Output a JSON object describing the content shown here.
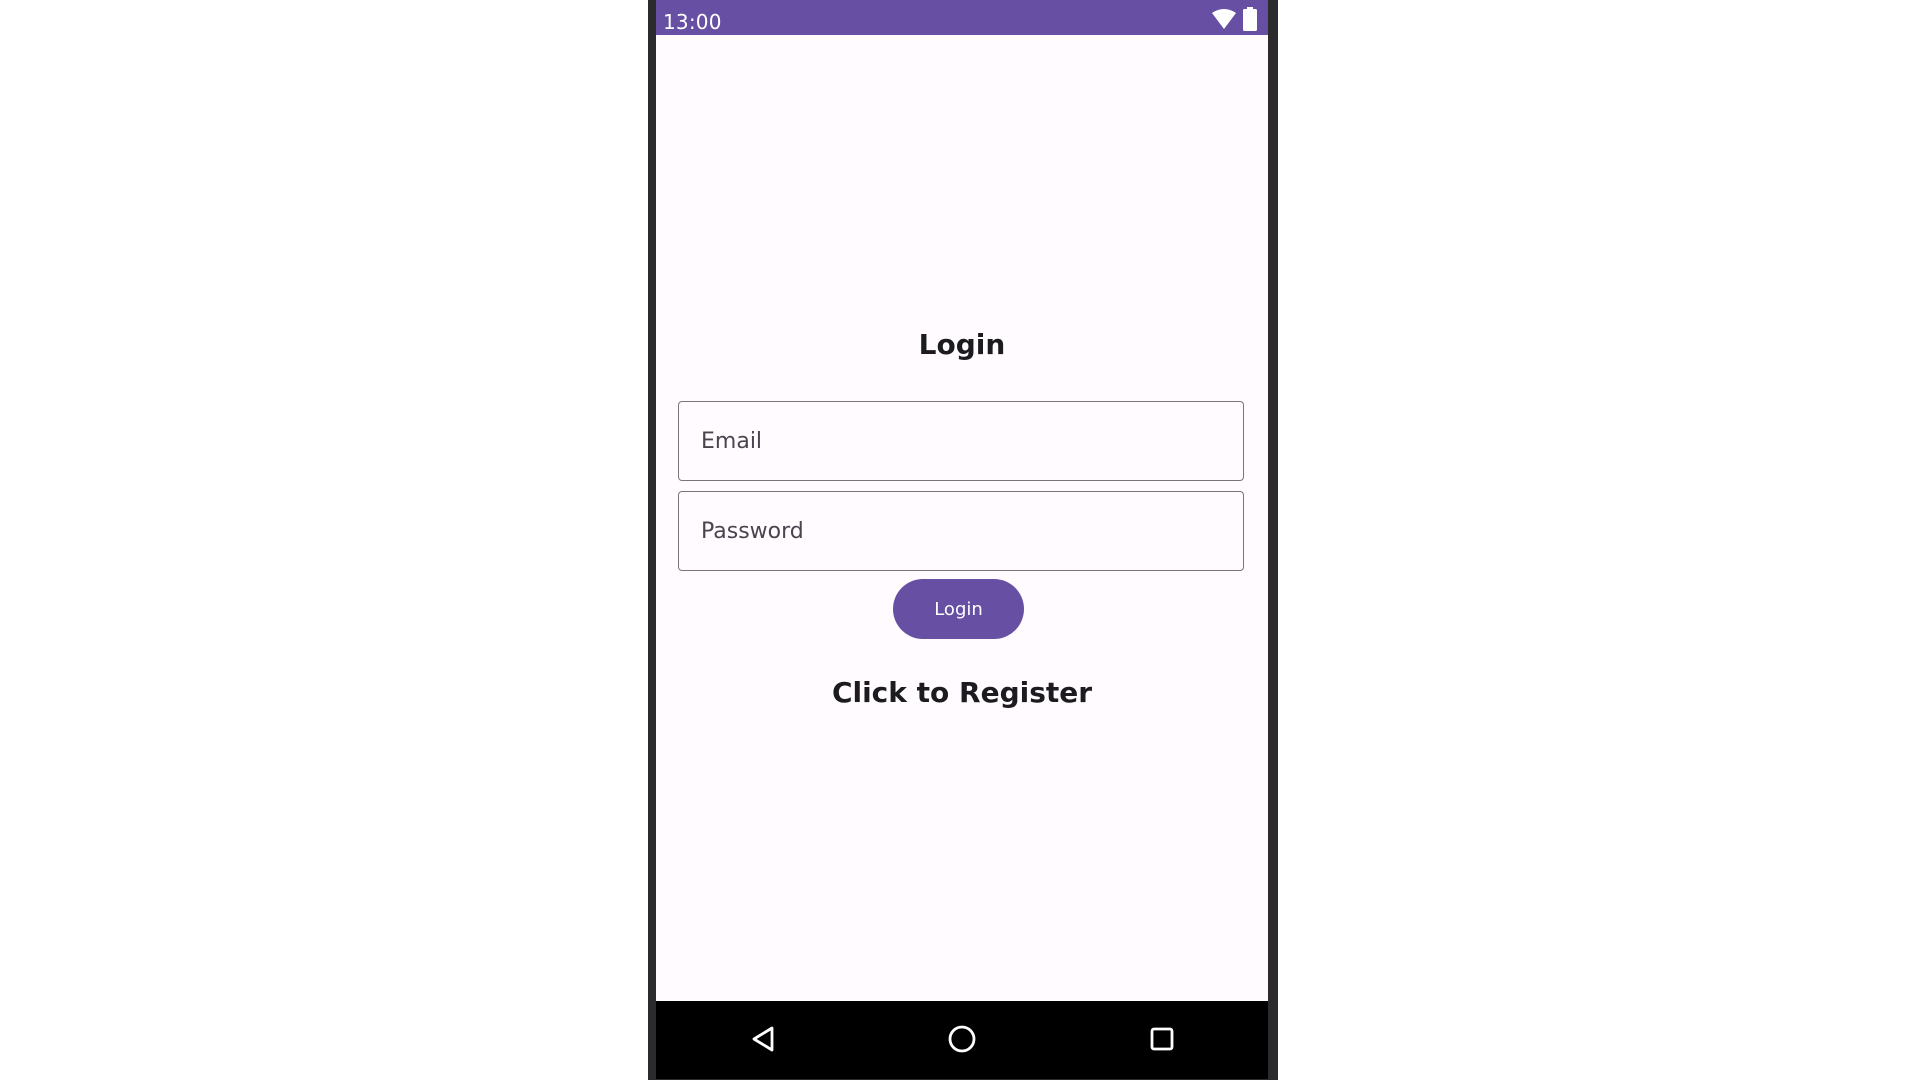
{
  "status_bar": {
    "time": "13:00",
    "icons": [
      "wifi-icon",
      "battery-icon"
    ],
    "color": "#6750a4"
  },
  "login": {
    "title": "Login",
    "email_placeholder": "Email",
    "email_value": "",
    "password_placeholder": "Password",
    "password_value": "",
    "button_label": "Login",
    "register_label": "Click to Register"
  },
  "nav_bar": {
    "icons": [
      "back-icon",
      "home-icon",
      "recents-icon"
    ]
  },
  "colors": {
    "primary": "#6750a4",
    "background": "#fffbfe",
    "on_surface": "#1c1b1f",
    "outline": "#79747e"
  }
}
